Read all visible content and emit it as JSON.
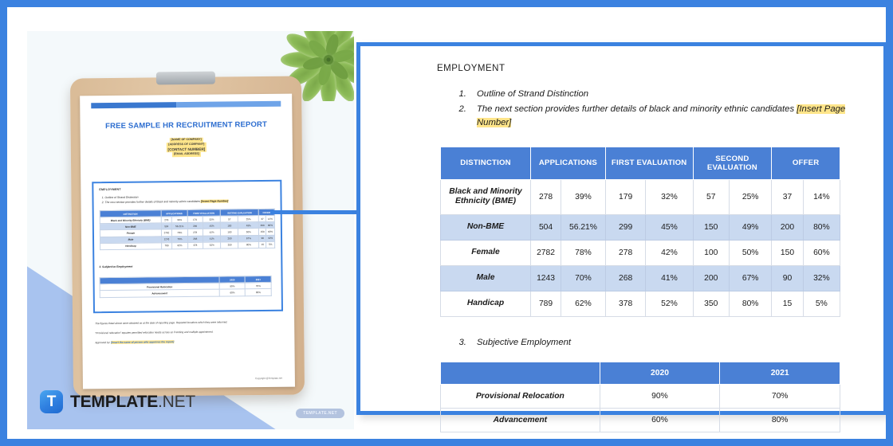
{
  "brand": {
    "logo_letter": "T",
    "logo_name_bold": "TEMPLATE",
    "logo_name_light": ".NET",
    "watermark": "TEMPLATE.NET"
  },
  "colors": {
    "frame_blue": "#3b82e0",
    "table_header_blue": "#4a80d5",
    "alt_row_blue": "#c9d9f0",
    "highlight_yellow": "#ffe58a",
    "clipboard_tan": "#d9bb97",
    "diagonal_periwinkle": "#a8c3ef"
  },
  "document": {
    "title": "FREE SAMPLE HR RECRUITMENT REPORT",
    "placeholders": [
      "[NAME OF COMPANY]",
      "[ADDRESS OF COMPANY]",
      "[CONTACT NUMBER]",
      "[EMAIL ADDRESS]"
    ],
    "copyright": "Copyright @Template.net",
    "footnote_1": "The figures listed above were obtained as at the date of reporting page. Reported locations which they were informed.",
    "footnote_2": "\"Provisional relocation\" equates permitted relocation heads across an if ending and multiple appointment.",
    "signature_label": "Approved by:",
    "signature_value": "[Insert the name of person who approves the report]"
  },
  "report": {
    "section_title": "EMPLOYMENT",
    "items": [
      {
        "num": "1.",
        "text": "Outline of Strand Distinction",
        "highlight": ""
      },
      {
        "num": "2.",
        "text": "The next section provides further details of black and minority ethnic candidates ",
        "highlight": "[Insert Page Number]"
      }
    ],
    "subjective_item": {
      "num": "3.",
      "text": "Subjective Employment"
    }
  },
  "main_table": {
    "headers": [
      "DISTINCTION",
      "APPLICATIONS",
      "FIRST EVALUATION",
      "SECOND EVALUATION",
      "OFFER"
    ],
    "rows": [
      {
        "label": "Black and Minority Ethnicity (BME)",
        "applications": "278",
        "applications_pct": "39%",
        "first": "179",
        "first_pct": "32%",
        "second": "57",
        "second_pct": "25%",
        "offer": "37",
        "offer_pct": "14%"
      },
      {
        "label": "Non-BME",
        "applications": "504",
        "applications_pct": "56.21%",
        "first": "299",
        "first_pct": "45%",
        "second": "150",
        "second_pct": "49%",
        "offer": "200",
        "offer_pct": "80%"
      },
      {
        "label": "Female",
        "applications": "2782",
        "applications_pct": "78%",
        "first": "278",
        "first_pct": "42%",
        "second": "100",
        "second_pct": "50%",
        "offer": "150",
        "offer_pct": "60%"
      },
      {
        "label": "Male",
        "applications": "1243",
        "applications_pct": "70%",
        "first": "268",
        "first_pct": "41%",
        "second": "200",
        "second_pct": "67%",
        "offer": "90",
        "offer_pct": "32%"
      },
      {
        "label": "Handicap",
        "applications": "789",
        "applications_pct": "62%",
        "first": "378",
        "first_pct": "52%",
        "second": "350",
        "second_pct": "80%",
        "offer": "15",
        "offer_pct": "5%"
      }
    ]
  },
  "sub_table": {
    "headers": [
      "",
      "2020",
      "2021"
    ],
    "rows": [
      {
        "label": "Provisional Relocation",
        "y2020": "90%",
        "y2021": "70%"
      },
      {
        "label": "Advancement",
        "y2020": "60%",
        "y2021": "80%"
      }
    ]
  }
}
